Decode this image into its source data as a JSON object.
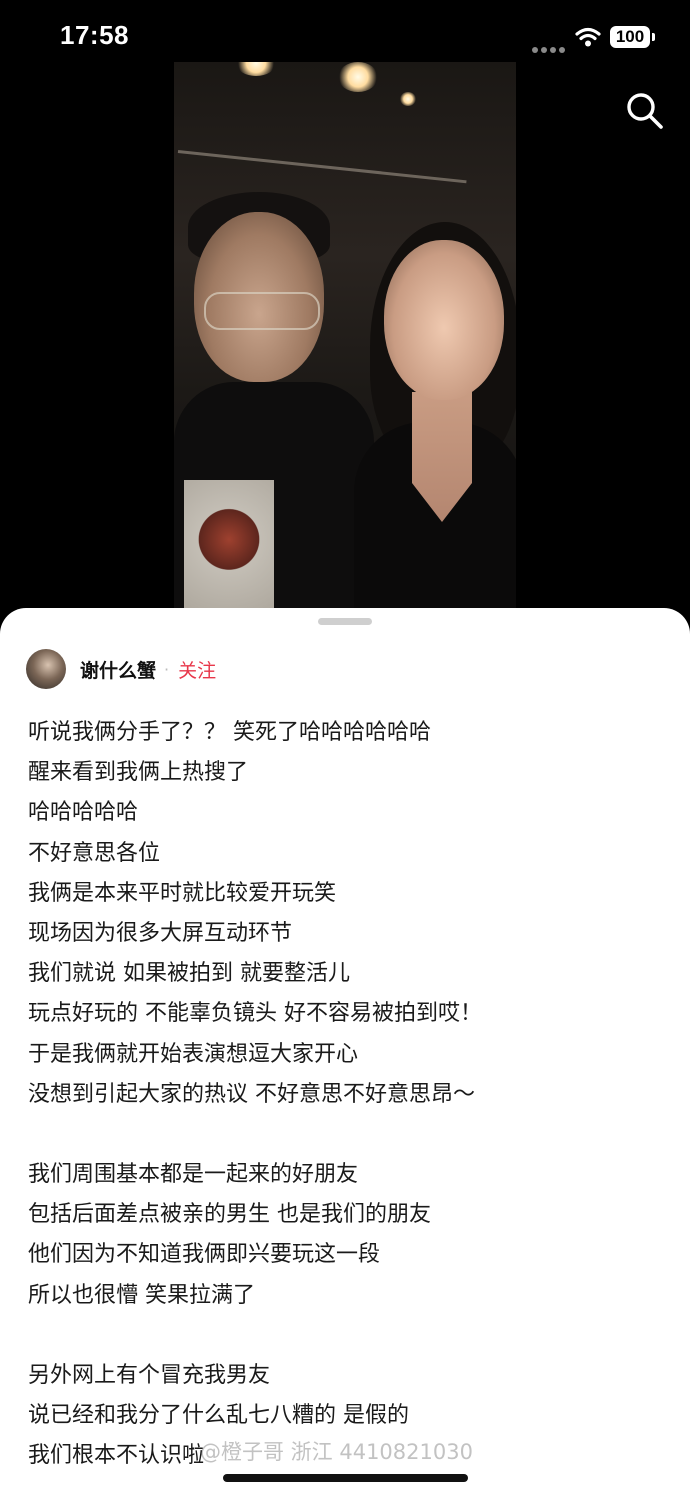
{
  "status_bar": {
    "time": "17:58",
    "battery": "100"
  },
  "post": {
    "author": "谢什么蟹",
    "follow_label": "关注",
    "lines": [
      "听说我俩分手了？？  笑死了哈哈哈哈哈哈",
      "醒来看到我俩上热搜了",
      "哈哈哈哈哈",
      "不好意思各位",
      "我俩是本来平时就比较爱开玩笑",
      "现场因为很多大屏互动环节",
      "我们就说 如果被拍到 就要整活儿",
      "玩点好玩的 不能辜负镜头 好不容易被拍到哎！",
      "于是我俩就开始表演想逗大家开心",
      "没想到引起大家的热议 不好意思不好意思昂～",
      "",
      "我们周围基本都是一起来的好朋友",
      "包括后面差点被亲的男生 也是我们的朋友",
      "他们因为不知道我俩即兴要玩这一段",
      "所以也很懵 笑果拉满了",
      "",
      "另外网上有个冒充我男友",
      "说已经和我分了什么乱七八糟的 是假的",
      "我们根本不认识啦"
    ],
    "watermark": "@橙子哥 浙江 4410821030"
  },
  "icons": {
    "search": "search-icon",
    "wifi": "wifi-icon",
    "battery": "battery-icon"
  }
}
